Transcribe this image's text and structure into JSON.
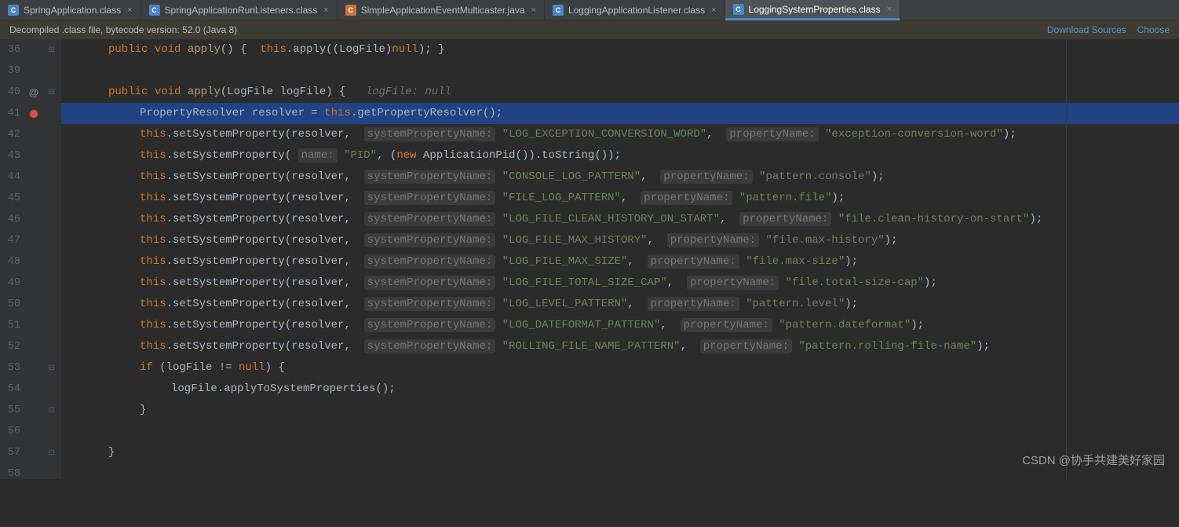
{
  "tabs": [
    {
      "label": "SpringApplication.class",
      "type": "class"
    },
    {
      "label": "SpringApplicationRunListeners.class",
      "type": "class"
    },
    {
      "label": "SimpleApplicationEventMulticaster.java",
      "type": "java"
    },
    {
      "label": "LoggingApplicationListener.class",
      "type": "class"
    },
    {
      "label": "LoggingSystemProperties.class",
      "type": "class",
      "active": true
    }
  ],
  "info": {
    "msg": "Decompiled .class file, bytecode version: 52.0 (Java 8)",
    "link1": "Download Sources",
    "link2": "Choose"
  },
  "lines": {
    "start": 36,
    "count": 23
  },
  "code": {
    "l36_kw1": "public",
    "l36_kw2": "void",
    "l36_m": "apply",
    "l36_kw3": "this",
    "l36_m2": ".apply((LogFile)",
    "l36_kw4": "null",
    "l36_end": "); }",
    "l40_kw1": "public",
    "l40_kw2": "void",
    "l40_m": "apply",
    "l40_sig": "(LogFile logFile) {",
    "l40_hint": "logFile: null",
    "l41_a": "PropertyResolver resolver = ",
    "l41_kw": "this",
    "l41_b": ".getPropertyResolver();",
    "l42_kw": "this",
    "l42_m": ".setSystemProperty",
    "l42_a": "(resolver, ",
    "l42_h1": "systemPropertyName:",
    "l42_s1": "\"LOG_EXCEPTION_CONVERSION_WORD\"",
    "l42_c": ", ",
    "l42_h2": "propertyName:",
    "l42_s2": "\"exception-conversion-word\"",
    "l42_e": ");",
    "l43_kw": "this",
    "l43_m": ".setSystemProperty",
    "l43_a": "(",
    "l43_h1": "name:",
    "l43_s1": "\"PID\"",
    "l43_c": ", (",
    "l43_kw2": "new",
    "l43_b": " ApplicationPid()).toString());",
    "l44_s1": "\"CONSOLE_LOG_PATTERN\"",
    "l44_s2": "\"pattern.console\"",
    "l45_s1": "\"FILE_LOG_PATTERN\"",
    "l45_s2": "\"pattern.file\"",
    "l46_s1": "\"LOG_FILE_CLEAN_HISTORY_ON_START\"",
    "l46_s2": "\"file.clean-history-on-start\"",
    "l47_s1": "\"LOG_FILE_MAX_HISTORY\"",
    "l47_s2": "\"file.max-history\"",
    "l48_s1": "\"LOG_FILE_MAX_SIZE\"",
    "l48_s2": "\"file.max-size\"",
    "l49_s1": "\"LOG_FILE_TOTAL_SIZE_CAP\"",
    "l49_s2": "\"file.total-size-cap\"",
    "l50_s1": "\"LOG_LEVEL_PATTERN\"",
    "l50_s2": "\"pattern.level\"",
    "l51_s1": "\"LOG_DATEFORMAT_PATTERN\"",
    "l51_s2": "\"pattern.dateformat\"",
    "l52_s1": "\"ROLLING_FILE_NAME_PATTERN\"",
    "l52_s2": "\"pattern.rolling-file-name\"",
    "hSys": "systemPropertyName:",
    "hProp": "propertyName:",
    "l53_kw": "if",
    "l53_a": " (logFile != ",
    "l53_kw2": "null",
    "l53_b": ") {",
    "l54": "logFile.applyToSystemProperties();",
    "l55": "}",
    "l57": "}"
  },
  "watermark": "CSDN @协手共建美好家园"
}
